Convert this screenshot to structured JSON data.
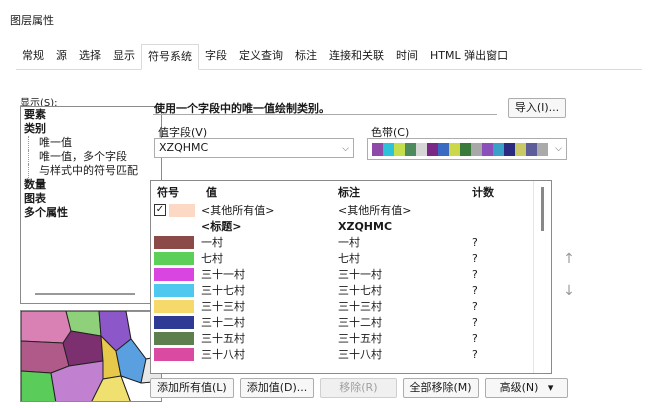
{
  "window": {
    "title": "图层属性"
  },
  "tabs": [
    "常规",
    "源",
    "选择",
    "显示",
    "符号系统",
    "字段",
    "定义查询",
    "标注",
    "连接和关联",
    "时间",
    "HTML 弹出窗口"
  ],
  "active_tab": "符号系统",
  "left": {
    "show_label": "显示(S):",
    "tree": [
      {
        "label": "要素",
        "bold": true
      },
      {
        "label": "类别",
        "bold": true
      },
      {
        "label": "唯一值",
        "bold": false,
        "sub": true
      },
      {
        "label": "唯一值，多个字段",
        "bold": false,
        "sub": true
      },
      {
        "label": "与样式中的符号匹配",
        "bold": false,
        "sub": true
      },
      {
        "label": "数量",
        "bold": true
      },
      {
        "label": "图表",
        "bold": true
      },
      {
        "label": "多个属性",
        "bold": true
      }
    ]
  },
  "main": {
    "description": "使用一个字段中的唯一值绘制类别。",
    "import_label": "导入(I)...",
    "value_field_label": "值字段(V)",
    "value_field_value": "XZQHMC",
    "color_ramp_label": "色带(C)",
    "color_ramp_colors": [
      "#8e4aa8",
      "#2cc2d9",
      "#c4de4d",
      "#4d8a5c",
      "#d6d6d6",
      "#7a2a86",
      "#3b6ac2",
      "#ccd84a",
      "#3a7a3a",
      "#a8a8a8",
      "#8a4fb8",
      "#3aa0c8",
      "#2a2a80",
      "#c9c966",
      "#5d5d9a",
      "#aaaaaa"
    ]
  },
  "table": {
    "headers": {
      "symbol": "符号",
      "value": "值",
      "label": "标注",
      "count": "计数"
    },
    "rows": [
      {
        "type": "check",
        "color": "#fbd9c4",
        "value": "<其他所有值>",
        "label": "<其他所有值>",
        "count": ""
      },
      {
        "type": "heading",
        "color": "",
        "value": "<标题>",
        "label": "XZQHMC",
        "count": ""
      },
      {
        "type": "item",
        "color": "#8b4a48",
        "value": "一村",
        "label": "一村",
        "count": "?"
      },
      {
        "type": "item",
        "color": "#5bcf58",
        "value": "七村",
        "label": "七村",
        "count": "?"
      },
      {
        "type": "item",
        "color": "#d945e0",
        "value": "三十一村",
        "label": "三十一村",
        "count": "?"
      },
      {
        "type": "item",
        "color": "#4fc8f0",
        "value": "三十七村",
        "label": "三十七村",
        "count": "?"
      },
      {
        "type": "item",
        "color": "#f5d96a",
        "value": "三十三村",
        "label": "三十三村",
        "count": "?"
      },
      {
        "type": "item",
        "color": "#2e3a93",
        "value": "三十二村",
        "label": "三十二村",
        "count": "?"
      },
      {
        "type": "item",
        "color": "#5f7e4e",
        "value": "三十五村",
        "label": "三十五村",
        "count": "?"
      },
      {
        "type": "item",
        "color": "#d94aa0",
        "value": "三十八村",
        "label": "三十八村",
        "count": "?"
      }
    ]
  },
  "buttons": {
    "add_all": "添加所有值(L)",
    "add_values": "添加值(D)...",
    "remove": "移除(R)",
    "remove_all": "全部移除(M)",
    "advanced": "高级(N)",
    "advanced_arrow": "▾",
    "move_up": "↑",
    "move_down": "↓"
  }
}
